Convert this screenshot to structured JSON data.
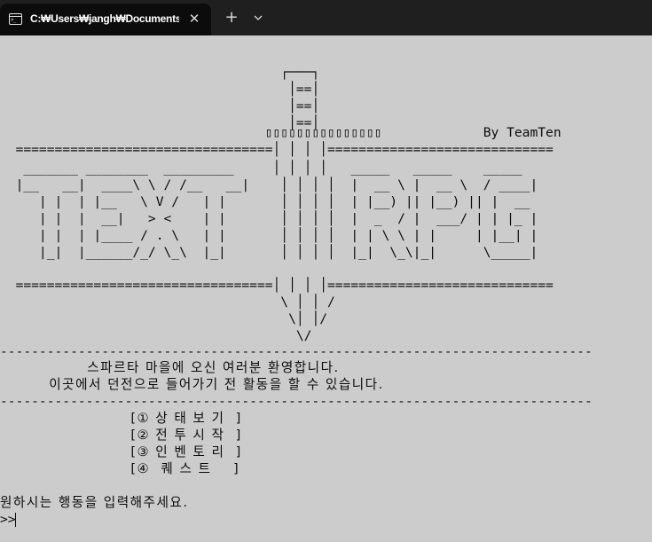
{
  "tab": {
    "title": "C:₩Users₩jangh₩Documents₩",
    "close_glyph": "✕",
    "new_tab_glyph": "+",
    "icon": "terminal-icon",
    "icon_prompt": ">_"
  },
  "colors": {
    "titlebar": "#1f1f1f",
    "tab": "#0c0c0c",
    "terminal_bg": "#cccccc",
    "terminal_fg": "#0c0c0c"
  },
  "terminal": {
    "lines": [
      "                                    ┌───┐",
      "                                     │==│",
      "                                     │==│",
      "                                     │==│",
      "                                  ▯▯▯▯▯▯▯▯▯▯▯▯▯▯▯             By TeamTen",
      "  =================================│ │ │ │=============================",
      "   _______ ________  _________     │ │ │ │   _____   _____    _____",
      "  |__   __|  ____\\ \\ / /__   __|    │ │ │ │  |  __ \\ |  __ \\  / ____|",
      "     | |  | |__   \\ V /   | |       │ │ │ │  | |__) || |__) || |  __",
      "     | |  |  __|   > <    | |       │ │ │ │  |  _  / |  ___/ | | |_ |",
      "     | |  | |____ / . \\   | |       │ │ │ │  | | \\ \\ | |     | |__| |",
      "     |_|  |______/_/ \\_\\  |_|       │ │ │ │  |_|  \\_\\|_|      \\_____|",
      "",
      "  =================================│ │ │ │=============================",
      "                                    \\ │ │ /",
      "                                     \\│ │/",
      "                                      \\/",
      "----------------------------------------------------------------------------",
      "                스파르타 마을에 오신 여러분 환영합니다.",
      "         이곳에서 던전으로 들어가기 전 활동을 할 수 있습니다.",
      "----------------------------------------------------------------------------",
      "                        [① 상 태 보 기  ]",
      "                        [② 전 투 시 작  ]",
      "                        [③ 인 벤 토 리  ]",
      "                        [④  퀘 스 트    ]",
      "",
      "원하시는 행동을 입력해주세요.",
      ">>"
    ]
  }
}
